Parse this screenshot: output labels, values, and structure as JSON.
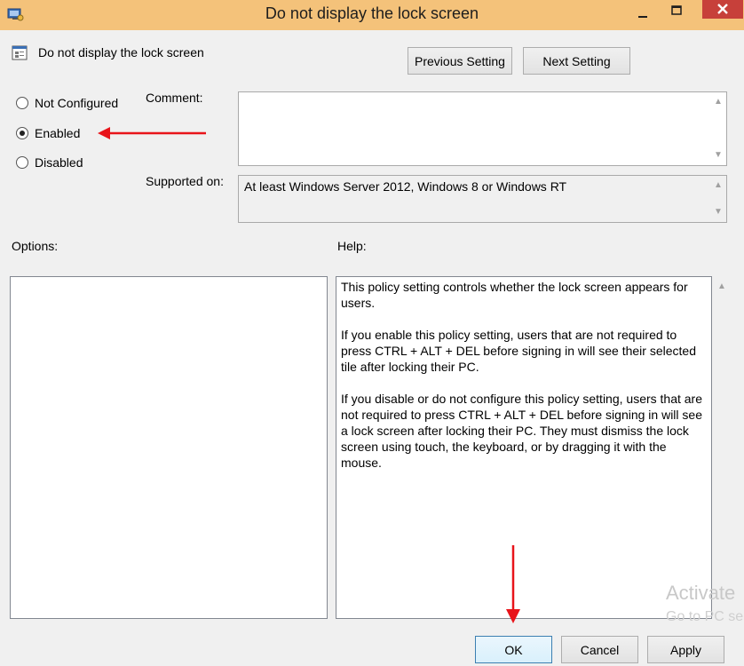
{
  "window": {
    "title": "Do not display the lock screen",
    "titlebar_color": "#f4c27a",
    "close_color": "#c7403a"
  },
  "policy": {
    "name": "Do not display the lock screen"
  },
  "nav": {
    "previous_label": "Previous Setting",
    "next_label": "Next Setting"
  },
  "state": {
    "options": [
      {
        "label": "Not Configured",
        "checked": false
      },
      {
        "label": "Enabled",
        "checked": true
      },
      {
        "label": "Disabled",
        "checked": false
      }
    ]
  },
  "comment": {
    "label": "Comment:",
    "value": ""
  },
  "supported": {
    "label": "Supported on:",
    "value": "At least Windows Server 2012, Windows 8 or Windows RT"
  },
  "options_panel": {
    "label": "Options:"
  },
  "help_panel": {
    "label": "Help:",
    "paragraphs": [
      "This policy setting controls whether the lock screen appears for users.",
      "If you enable this policy setting, users that are not required to press CTRL + ALT + DEL before signing in will see their selected tile after  locking their PC.",
      "If you disable or do not configure this policy setting, users that are not required to press CTRL + ALT + DEL before signing in will see a lock screen after locking their PC. They must dismiss the lock screen using touch, the keyboard, or by dragging it with the mouse."
    ]
  },
  "footer": {
    "ok_label": "OK",
    "cancel_label": "Cancel",
    "apply_label": "Apply"
  },
  "watermark": {
    "line1": "Activate",
    "line2": "Go to PC se"
  },
  "annotation_color": "#e8141a"
}
